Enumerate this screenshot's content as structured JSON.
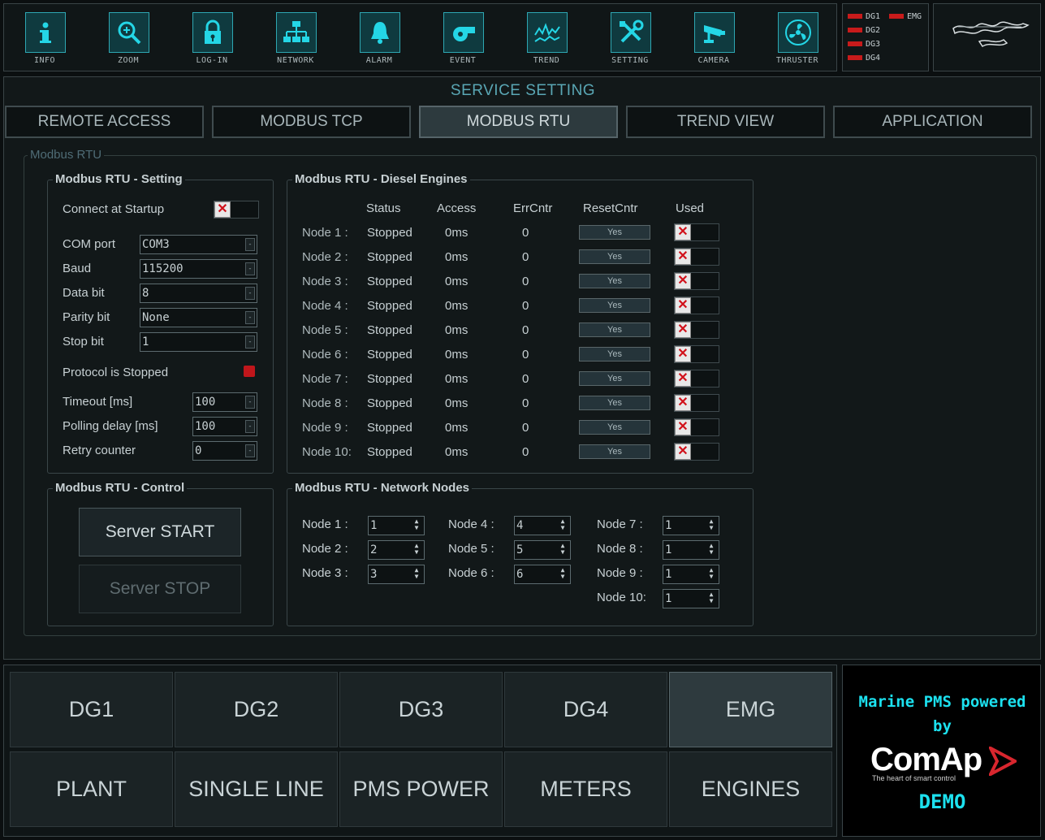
{
  "toolbar": {
    "items": [
      {
        "label": "INFO",
        "icon": "info-icon"
      },
      {
        "label": "ZOOM",
        "icon": "zoom-icon"
      },
      {
        "label": "LOG-IN",
        "icon": "lock-icon"
      },
      {
        "label": "NETWORK",
        "icon": "network-icon"
      },
      {
        "label": "ALARM",
        "icon": "bell-icon"
      },
      {
        "label": "EVENT",
        "icon": "whistle-icon"
      },
      {
        "label": "TREND",
        "icon": "trend-icon"
      },
      {
        "label": "SETTING",
        "icon": "tools-icon"
      },
      {
        "label": "CAMERA",
        "icon": "camera-icon"
      },
      {
        "label": "THRUSTER",
        "icon": "fan-icon"
      }
    ]
  },
  "status": {
    "items": [
      "DG1",
      "EMG",
      "DG2",
      "DG3",
      "DG4"
    ],
    "led_color": "#c81b1b"
  },
  "page_title": "SERVICE SETTING",
  "tabs": [
    "REMOTE ACCESS",
    "MODBUS TCP",
    "MODBUS RTU",
    "TREND VIEW",
    "APPLICATION"
  ],
  "active_tab": "MODBUS RTU",
  "panel_title": "Modbus RTU",
  "setting": {
    "title": "Modbus RTU  - Setting",
    "connect_label": "Connect at Startup",
    "fields": [
      {
        "label": "COM port",
        "value": "COM3"
      },
      {
        "label": "Baud",
        "value": "115200"
      },
      {
        "label": "Data bit",
        "value": "8"
      },
      {
        "label": "Parity bit",
        "value": "None"
      },
      {
        "label": "Stop bit",
        "value": "1"
      }
    ],
    "protocol_status": "Protocol is Stopped",
    "timing": [
      {
        "label": "Timeout [ms]",
        "value": "100"
      },
      {
        "label": "Polling delay [ms]",
        "value": "100"
      },
      {
        "label": "Retry counter",
        "value": "0"
      }
    ]
  },
  "control": {
    "title": "Modbus RTU - Control",
    "start_label": "Server START",
    "stop_label": "Server STOP"
  },
  "engines": {
    "title": "Modbus RTU - Diesel Engines",
    "headers": [
      "Status",
      "Access",
      "ErrCntr",
      "ResetCntr",
      "Used"
    ],
    "rows": [
      {
        "node": "Node 1 :",
        "status": "Stopped",
        "access": "0ms",
        "err": "0",
        "reset": "Yes"
      },
      {
        "node": "Node 2 :",
        "status": "Stopped",
        "access": "0ms",
        "err": "0",
        "reset": "Yes"
      },
      {
        "node": "Node 3 :",
        "status": "Stopped",
        "access": "0ms",
        "err": "0",
        "reset": "Yes"
      },
      {
        "node": "Node 4 :",
        "status": "Stopped",
        "access": "0ms",
        "err": "0",
        "reset": "Yes"
      },
      {
        "node": "Node 5 :",
        "status": "Stopped",
        "access": "0ms",
        "err": "0",
        "reset": "Yes"
      },
      {
        "node": "Node 6 :",
        "status": "Stopped",
        "access": "0ms",
        "err": "0",
        "reset": "Yes"
      },
      {
        "node": "Node 7 :",
        "status": "Stopped",
        "access": "0ms",
        "err": "0",
        "reset": "Yes"
      },
      {
        "node": "Node 8 :",
        "status": "Stopped",
        "access": "0ms",
        "err": "0",
        "reset": "Yes"
      },
      {
        "node": "Node 9 :",
        "status": "Stopped",
        "access": "0ms",
        "err": "0",
        "reset": "Yes"
      },
      {
        "node": "Node 10:",
        "status": "Stopped",
        "access": "0ms",
        "err": "0",
        "reset": "Yes"
      }
    ]
  },
  "network": {
    "title": "Modbus RTU -  Network Nodes",
    "nodes": [
      {
        "label": "Node 1 :",
        "value": "1"
      },
      {
        "label": "Node 2 :",
        "value": "2"
      },
      {
        "label": "Node 3 :",
        "value": "3"
      },
      {
        "label": "Node 4 :",
        "value": "4"
      },
      {
        "label": "Node 5 :",
        "value": "5"
      },
      {
        "label": "Node 6 :",
        "value": "6"
      },
      {
        "label": "Node 7 :",
        "value": "1"
      },
      {
        "label": "Node 8 :",
        "value": "1"
      },
      {
        "label": "Node 9 :",
        "value": "1"
      },
      {
        "label": "Node 10:",
        "value": "1"
      }
    ]
  },
  "bottom_nav": {
    "row1": [
      "DG1",
      "DG2",
      "DG3",
      "DG4",
      "EMG"
    ],
    "row2": [
      "PLANT",
      "SINGLE LINE",
      "PMS POWER",
      "METERS",
      "ENGINES"
    ],
    "active": "EMG"
  },
  "brand": {
    "line1": "Marine PMS powered",
    "line2": "by",
    "logo": "ComAp",
    "tagline": "The heart of smart control",
    "demo": "DEMO",
    "accent": "#1ce1ef",
    "logo_accent": "#d8262e"
  }
}
